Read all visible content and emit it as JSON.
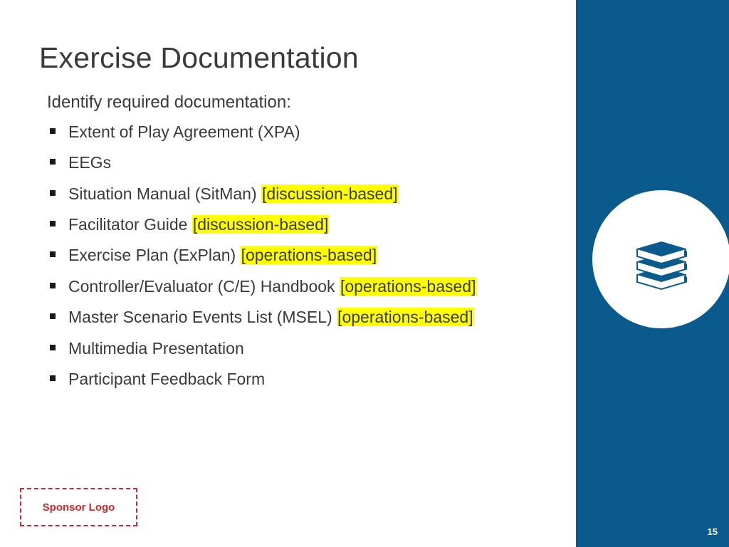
{
  "title": "Exercise Documentation",
  "intro": "Identify required documentation:",
  "items": [
    {
      "text": "Extent of Play Agreement (XPA)",
      "tag": ""
    },
    {
      "text": "EEGs",
      "tag": ""
    },
    {
      "text": "Situation Manual (SitMan) ",
      "tag": "[discussion-based]"
    },
    {
      "text": "Facilitator Guide ",
      "tag": "[discussion-based]"
    },
    {
      "text": "Exercise Plan (ExPlan) ",
      "tag": "[operations-based]"
    },
    {
      "text": "Controller/Evaluator (C/E) Handbook ",
      "tag": "[operations-based]"
    },
    {
      "text": "Master Scenario Events List (MSEL) ",
      "tag": "[operations-based]"
    },
    {
      "text": "Multimedia Presentation",
      "tag": ""
    },
    {
      "text": "Participant Feedback Form",
      "tag": ""
    }
  ],
  "sponsor_label": "Sponsor Logo",
  "page_number": "15",
  "colors": {
    "band": "#0b5a8d",
    "highlight": "#ffff00",
    "sponsor": "#d8232a",
    "text": "#3a3a3a"
  },
  "icon": "books-stack-icon"
}
